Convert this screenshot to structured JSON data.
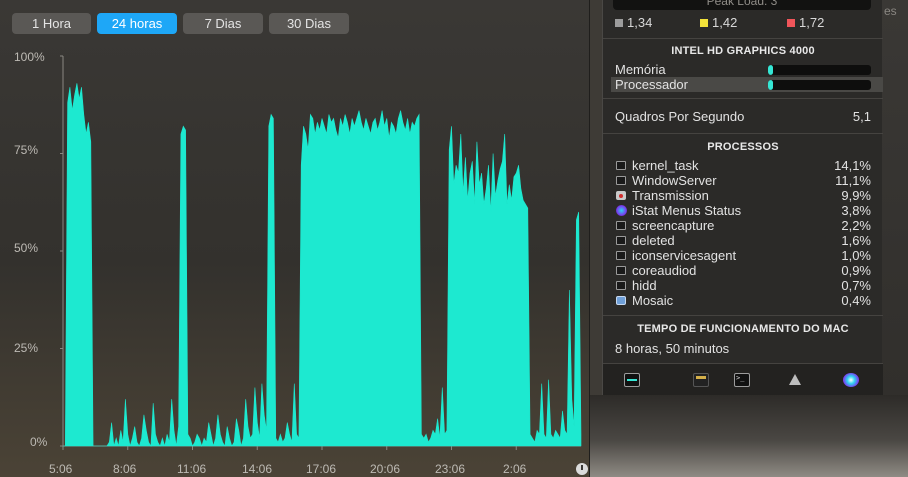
{
  "background": {
    "right_text": "es"
  },
  "graph": {
    "tabs": [
      {
        "label": "1 Hora",
        "active": false
      },
      {
        "label": "24 horas",
        "active": true
      },
      {
        "label": "7 Dias",
        "active": false
      },
      {
        "label": "30 Dias",
        "active": false
      }
    ],
    "icons": {
      "history": "clock-icon"
    }
  },
  "chart_data": {
    "type": "area",
    "title": "",
    "xlabel": "",
    "ylabel": "",
    "y_tick_labels": [
      "100%",
      "75%",
      "50%",
      "25%",
      "0%"
    ],
    "x_tick_labels": [
      "5:06",
      "8:06",
      "11:06",
      "14:06",
      "17:06",
      "20:06",
      "23:06",
      "2:06"
    ],
    "ylim": [
      0,
      100
    ],
    "grid": false,
    "legend": "none",
    "color": "#1de9d0",
    "series": [
      {
        "values": [
          0,
          0,
          88,
          92,
          86,
          90,
          93,
          89,
          92,
          85,
          80,
          83,
          78,
          0,
          0,
          0,
          0,
          0,
          0,
          0,
          1,
          6,
          0,
          2,
          0,
          4,
          1,
          12,
          3,
          0,
          2,
          5,
          1,
          0,
          2,
          8,
          4,
          1,
          0,
          11,
          3,
          1,
          0,
          2,
          0,
          3,
          1,
          12,
          4,
          0,
          5,
          80,
          82,
          81,
          3,
          2,
          0,
          1,
          3,
          2,
          0,
          2,
          1,
          6,
          3,
          0,
          2,
          8,
          3,
          1,
          0,
          5,
          2,
          0,
          1,
          7,
          4,
          0,
          2,
          12,
          5,
          2,
          3,
          15,
          6,
          2,
          16,
          8,
          4,
          82,
          85,
          84,
          2,
          1,
          3,
          1,
          2,
          6,
          3,
          1,
          16,
          3,
          2,
          72,
          82,
          80,
          76,
          85,
          84,
          80,
          83,
          81,
          84,
          82,
          80,
          85,
          83,
          84,
          81,
          79,
          84,
          82,
          85,
          83,
          80,
          84,
          82,
          84,
          86,
          83,
          81,
          84,
          82,
          80,
          83,
          84,
          81,
          83,
          86,
          82,
          84,
          79,
          83,
          82,
          80,
          84,
          86,
          83,
          81,
          84,
          80,
          83,
          82,
          84,
          85,
          3,
          2,
          3,
          1,
          2,
          4,
          3,
          7,
          2,
          15,
          3,
          4,
          76,
          82,
          67,
          72,
          70,
          80,
          65,
          74,
          63,
          70,
          73,
          62,
          78,
          67,
          70,
          62,
          66,
          72,
          60,
          75,
          64,
          68,
          71,
          73,
          80,
          62,
          67,
          63,
          69,
          70,
          72,
          66,
          63,
          62,
          61,
          3,
          2,
          1,
          4,
          3,
          16,
          3,
          2,
          17,
          3,
          2,
          4,
          3,
          2,
          9,
          4,
          3,
          40,
          12,
          5,
          58,
          60,
          3
        ]
      }
    ]
  },
  "menu": {
    "peak_load": "Peak Load: 3",
    "load": [
      {
        "value": "1,34",
        "color": "#9c9c9c"
      },
      {
        "value": "1,42",
        "color": "#f2e23a"
      },
      {
        "value": "1,72",
        "color": "#f0555a"
      }
    ],
    "gpu": {
      "title": "INTEL HD GRAPHICS 4000",
      "memory_label": "Memória",
      "memory_level": 0.05,
      "processor_label": "Processador",
      "processor_level": 0.05,
      "fps_label": "Quadros Por Segundo",
      "fps_value": "5,1"
    },
    "processes": {
      "title": "PROCESSOS",
      "items": [
        {
          "name": "kernel_task",
          "pct": "14,1%",
          "icon": "terminal-icon"
        },
        {
          "name": "WindowServer",
          "pct": "11,1%",
          "icon": "terminal-icon"
        },
        {
          "name": "Transmission",
          "pct": "9,9%",
          "icon": "transmission-icon"
        },
        {
          "name": "iStat Menus Status",
          "pct": "3,8%",
          "icon": "istat-icon"
        },
        {
          "name": "screencapture",
          "pct": "2,2%",
          "icon": "terminal-icon"
        },
        {
          "name": "deleted",
          "pct": "1,6%",
          "icon": "terminal-icon"
        },
        {
          "name": "iconservicesagent",
          "pct": "1,0%",
          "icon": "terminal-icon"
        },
        {
          "name": "coreaudiod",
          "pct": "0,9%",
          "icon": "terminal-icon"
        },
        {
          "name": "hidd",
          "pct": "0,7%",
          "icon": "terminal-icon"
        },
        {
          "name": "Mosaic",
          "pct": "0,4%",
          "icon": "mosaic-icon"
        }
      ]
    },
    "uptime": {
      "title": "TEMPO DE FUNCIONAMENTO DO MAC",
      "value": "8 horas, 50 minutos"
    },
    "toolbar": [
      "activity-monitor-icon",
      "console-icon",
      "terminal-icon",
      "network-icon",
      "istat-menus-icon"
    ]
  }
}
